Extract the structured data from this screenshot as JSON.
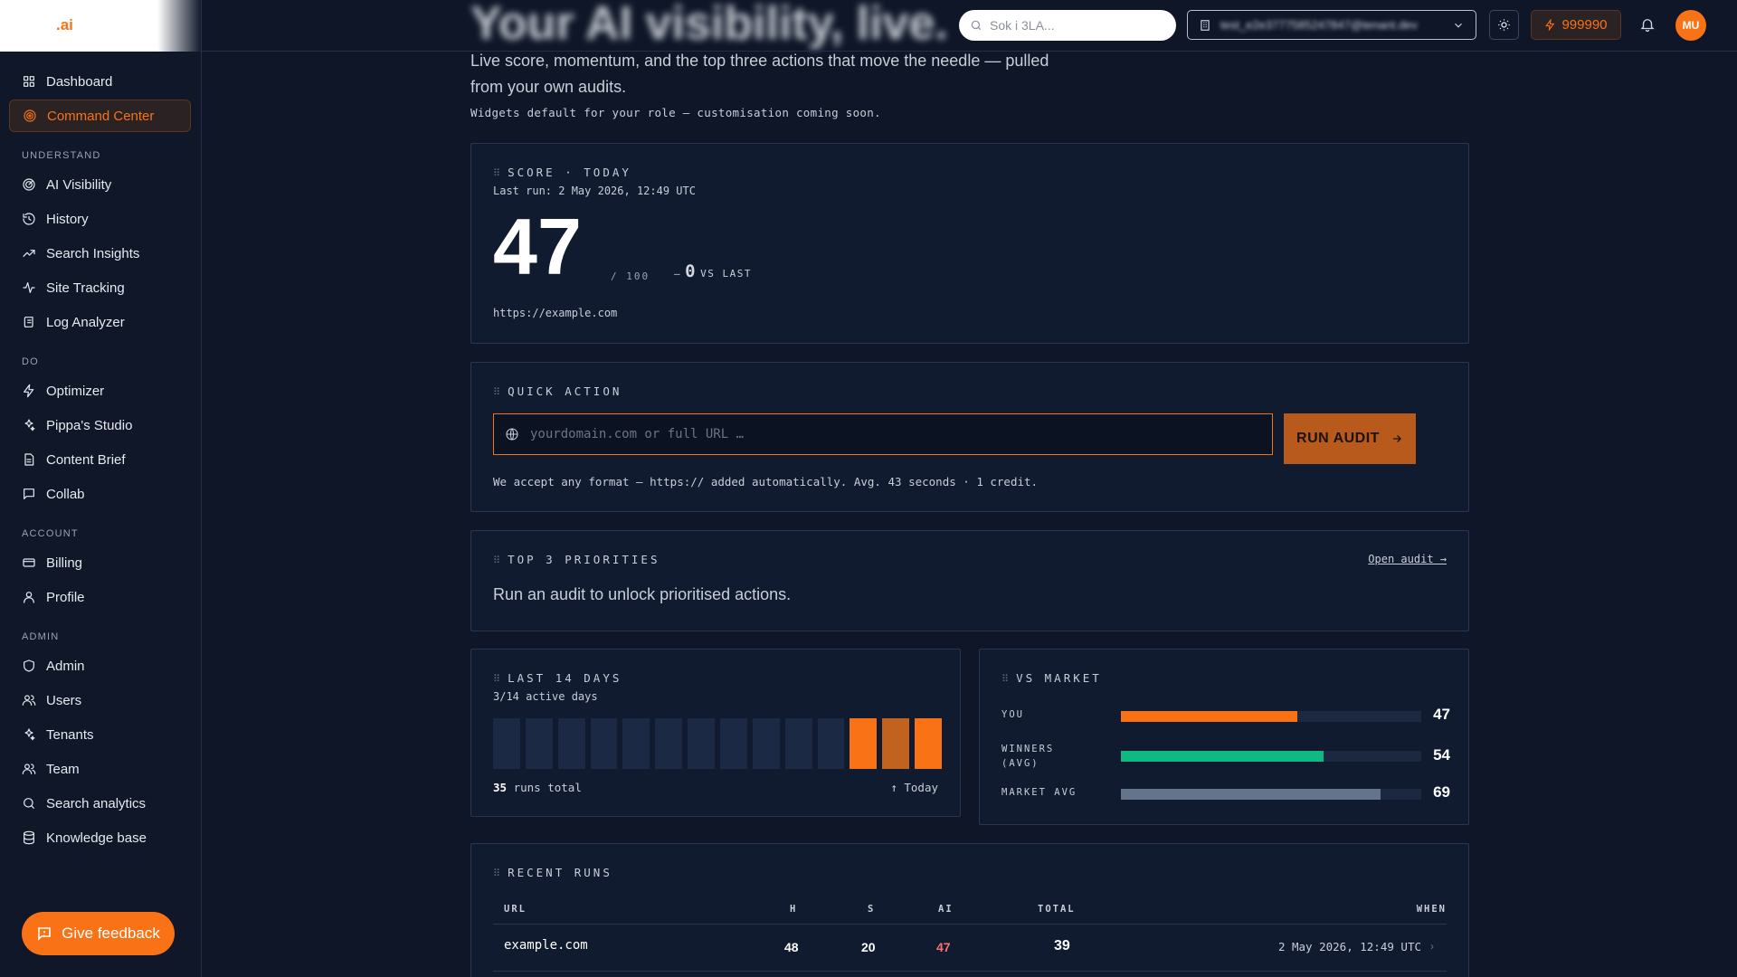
{
  "app": {
    "logo": ".ai",
    "blurred_title": "Your AI visibility, live.",
    "search_placeholder": "Sok i 3LA...",
    "tenant": "test_e2e3777585247847@tenant.dev",
    "credits": "999990",
    "avatar_initials": "MU",
    "accent_color": "#f97316"
  },
  "sidebar": {
    "top": [
      {
        "label": "Dashboard",
        "icon": "grid-icon"
      },
      {
        "label": "Command Center",
        "icon": "target-icon",
        "active": true
      }
    ],
    "sections": [
      {
        "title": "UNDERSTAND",
        "items": [
          {
            "label": "AI Visibility",
            "icon": "radar-icon"
          },
          {
            "label": "History",
            "icon": "history-icon"
          },
          {
            "label": "Search Insights",
            "icon": "trending-up-icon"
          },
          {
            "label": "Site Tracking",
            "icon": "activity-icon"
          },
          {
            "label": "Log Analyzer",
            "icon": "scroll-icon"
          }
        ]
      },
      {
        "title": "DO",
        "items": [
          {
            "label": "Optimizer",
            "icon": "bolt-icon"
          },
          {
            "label": "Pippa's Studio",
            "icon": "sparkles-icon"
          },
          {
            "label": "Content Brief",
            "icon": "document-icon"
          },
          {
            "label": "Collab",
            "icon": "message-icon"
          }
        ]
      },
      {
        "title": "ACCOUNT",
        "items": [
          {
            "label": "Billing",
            "icon": "credit-card-icon"
          },
          {
            "label": "Profile",
            "icon": "user-icon"
          }
        ]
      },
      {
        "title": "ADMIN",
        "items": [
          {
            "label": "Admin",
            "icon": "shield-icon"
          },
          {
            "label": "Users",
            "icon": "users-icon"
          },
          {
            "label": "Tenants",
            "icon": "sparkles-icon"
          },
          {
            "label": "Team",
            "icon": "users-icon"
          },
          {
            "label": "Search analytics",
            "icon": "search-icon"
          },
          {
            "label": "Knowledge base",
            "icon": "database-icon"
          }
        ]
      }
    ],
    "feedback_label": "Give feedback"
  },
  "header": {
    "subtitle": "Live score, momentum, and the top three actions that move the needle — pulled from your own audits.",
    "note": "Widgets default for your role — customisation coming soon."
  },
  "score_card": {
    "label": "SCORE · TODAY",
    "last_run": "Last run: 2 May 2026, 12:49 UTC",
    "score": "47",
    "out_of": "/ 100",
    "delta_prefix": "—",
    "delta_value": "0",
    "delta_suffix": "VS LAST",
    "url": "https://example.com"
  },
  "quick_action": {
    "label": "QUICK ACTION",
    "placeholder": "yourdomain.com or full URL …",
    "button": "RUN AUDIT",
    "help": "We accept any format — https:// added automatically. Avg. 43 seconds · 1 credit."
  },
  "priorities": {
    "label": "TOP 3 PRIORITIES",
    "link": "Open audit →",
    "message": "Run an audit to unlock prioritised actions."
  },
  "last14": {
    "label": "LAST 14 DAYS",
    "active": "3/14 active days",
    "runs_count": "35",
    "runs_suffix": "runs total",
    "today": "↑ Today",
    "levels": [
      0,
      0,
      0,
      0,
      0,
      0,
      0,
      0,
      0,
      0,
      0,
      1,
      0.8,
      1
    ]
  },
  "market": {
    "label": "VS MARKET",
    "rows": [
      {
        "label": "YOU",
        "value": "47",
        "fraction": 0.47,
        "color": "#f97316"
      },
      {
        "label": "WINNERS (AVG)",
        "value": "54",
        "fraction": 0.54,
        "color": "#10b981"
      },
      {
        "label": "MARKET AVG",
        "value": "69",
        "fraction": 0.69,
        "color": "#64748b"
      }
    ]
  },
  "recent_runs": {
    "label": "RECENT RUNS",
    "columns": [
      "URL",
      "H",
      "S",
      "AI",
      "TOTAL",
      "WHEN"
    ],
    "rows": [
      {
        "url": "example.com",
        "h": "48",
        "s": "20",
        "ai": "47",
        "total": "39",
        "when": "2 May 2026, 12:49 UTC"
      }
    ]
  }
}
